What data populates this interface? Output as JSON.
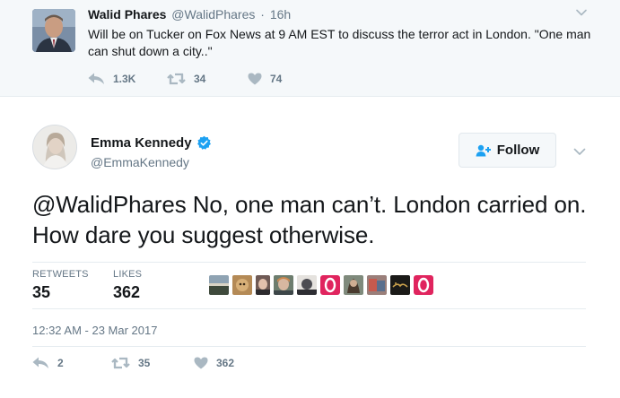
{
  "parent_tweet": {
    "author_name": "Walid Phares",
    "author_handle": "@WalidPhares",
    "separator": "·",
    "time_ago": "16h",
    "text": "Will be on Tucker on Fox News at 9 AM EST to discuss the terror act in London. \"One man can shut down a city..\"",
    "reply_count": "1.3K",
    "retweet_count": "34",
    "like_count": "74",
    "icons": [
      "reply-icon",
      "retweet-icon",
      "heart-icon",
      "chevron-down-icon"
    ]
  },
  "main_tweet": {
    "author_name": "Emma Kennedy",
    "author_handle": "@EmmaKennedy",
    "verified": true,
    "follow_label": "Follow",
    "text": "@WalidPhares No, one man can’t. London carried on. How dare you suggest otherwise.",
    "stats": {
      "retweets_label": "RETWEETS",
      "retweets_value": "35",
      "likes_label": "LIKES",
      "likes_value": "362"
    },
    "liker_avatar_count": 10,
    "timestamp": "12:32 AM - 23 Mar 2017",
    "reply_count": "2",
    "retweet_count": "35",
    "like_count": "362",
    "icons": [
      "verified-badge-icon",
      "follow-person-icon",
      "chevron-down-icon",
      "reply-icon",
      "retweet-icon",
      "heart-icon"
    ]
  },
  "colors": {
    "background": "#ffffff",
    "parent_background": "#f5f8fa",
    "text_primary": "#14171a",
    "text_secondary": "#657786",
    "icon_gray": "#aab8c2",
    "verified_blue": "#1da1f2",
    "divider": "#e6ecf0"
  }
}
